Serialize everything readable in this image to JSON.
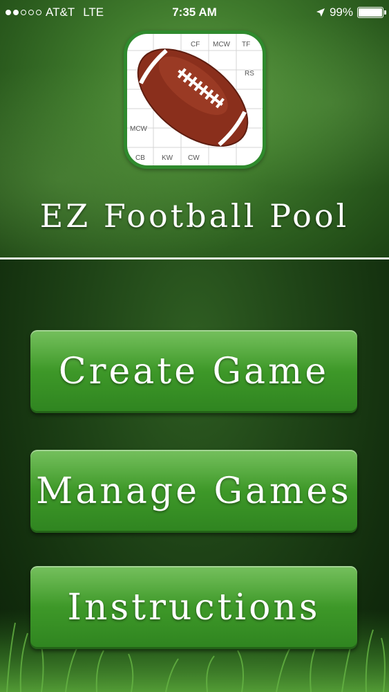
{
  "status_bar": {
    "carrier": "AT&T",
    "network": "LTE",
    "time": "7:35 AM",
    "battery_percent": "99%",
    "battery_level": 0.99,
    "signal_dots_filled": 2,
    "signal_dots_total": 5,
    "location_icon": "location-arrow-icon",
    "battery_icon": "battery-icon"
  },
  "app_icon": {
    "grid_labels": [
      "CF",
      "MCW",
      "TF",
      "RS",
      "MCW",
      "CB",
      "KW",
      "CW"
    ]
  },
  "title": "EZ Football Pool",
  "buttons": {
    "create": "Create Game",
    "manage": "Manage Games",
    "instructions": "Instructions"
  },
  "colors": {
    "button_green": "#3f9a29",
    "icon_border": "#2f8a2d",
    "football_brown": "#8a2f1c"
  }
}
